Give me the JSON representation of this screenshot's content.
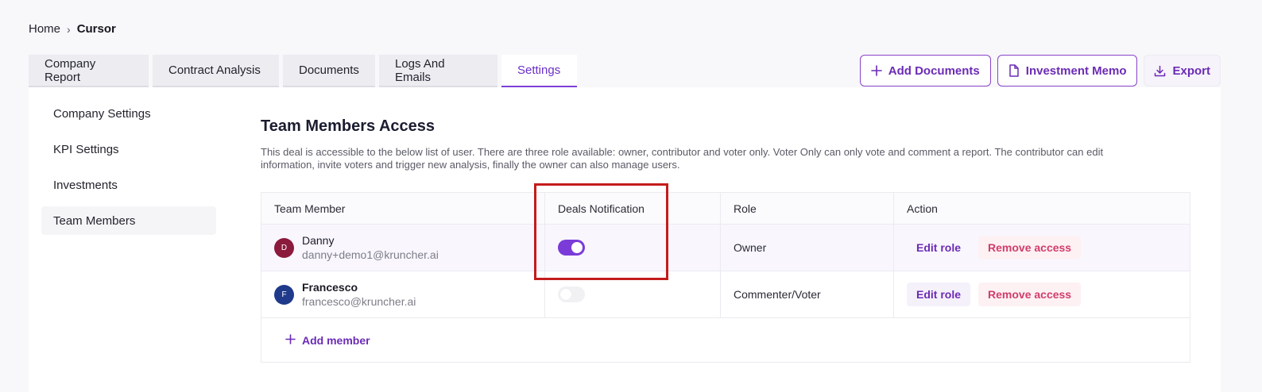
{
  "breadcrumb": {
    "home": "Home",
    "separator": "›",
    "current": "Cursor"
  },
  "tabs": [
    {
      "label": "Company Report"
    },
    {
      "label": "Contract Analysis"
    },
    {
      "label": "Documents"
    },
    {
      "label": "Logs And Emails"
    },
    {
      "label": "Settings",
      "active": true
    }
  ],
  "actions": {
    "add_documents": "Add Documents",
    "investment_memo": "Investment Memo",
    "export": "Export"
  },
  "sidenav": {
    "items": [
      {
        "label": "Company Settings"
      },
      {
        "label": "KPI Settings"
      },
      {
        "label": "Investments"
      },
      {
        "label": "Team Members",
        "active": true
      }
    ]
  },
  "content": {
    "title": "Team Members Access",
    "description": "This deal is accessible to the below list of user. There are three role available: owner, contributor and voter only. Voter Only can only vote and comment a report. The contributor can edit information, invite voters and trigger new analysis, finally the owner can also manage users."
  },
  "table": {
    "headers": {
      "member": "Team Member",
      "notification": "Deals Notification",
      "role": "Role",
      "action": "Action"
    },
    "rows": [
      {
        "initial": "D",
        "avatar_color": "#8b1a3c",
        "name": "Danny",
        "email": "danny+demo1@kruncher.ai",
        "notification_on": true,
        "role": "Owner",
        "edit_label": "Edit role",
        "remove_label": "Remove access"
      },
      {
        "initial": "F",
        "avatar_color": "#1f3a8a",
        "name": "Francesco",
        "email": "francesco@kruncher.ai",
        "notification_on": false,
        "role": "Commenter/Voter",
        "edit_label": "Edit role",
        "remove_label": "Remove access"
      }
    ],
    "add_member_label": "Add member"
  },
  "colors": {
    "accent": "#7a3bd8",
    "danger": "#d13d6a",
    "annotation": "#c41c1c"
  }
}
